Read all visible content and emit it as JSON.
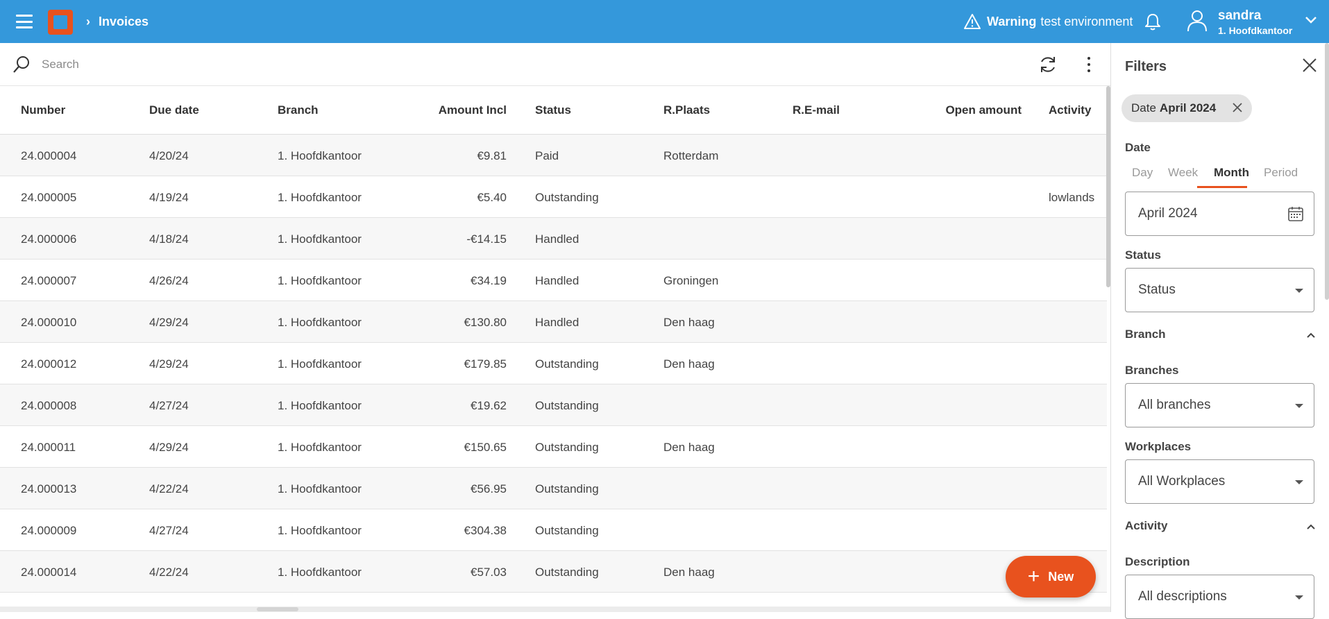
{
  "header": {
    "breadcrumb_title": "Invoices",
    "warning_bold": "Warning",
    "warning_text": "test environment",
    "user_name": "sandra",
    "user_branch": "1. Hoofdkantoor",
    "colors": {
      "bar": "#3498db",
      "accent": "#e8521e"
    }
  },
  "search": {
    "placeholder": "Search"
  },
  "table": {
    "columns": [
      "Number",
      "Due date",
      "Branch",
      "Amount Incl",
      "Status",
      "R.Plaats",
      "R.E-mail",
      "Open amount",
      "Activity"
    ],
    "rows": [
      {
        "number": "24.000004",
        "due": "4/20/24",
        "branch": "1. Hoofdkantoor",
        "amount": "€9.81",
        "status": "Paid",
        "plaats": "Rotterdam",
        "email": "",
        "open": "",
        "activity": ""
      },
      {
        "number": "24.000005",
        "due": "4/19/24",
        "branch": "1. Hoofdkantoor",
        "amount": "€5.40",
        "status": "Outstanding",
        "plaats": "",
        "email": "",
        "open": "",
        "activity": "lowlands"
      },
      {
        "number": "24.000006",
        "due": "4/18/24",
        "branch": "1. Hoofdkantoor",
        "amount": "-€14.15",
        "status": "Handled",
        "plaats": "",
        "email": "",
        "open": "",
        "activity": ""
      },
      {
        "number": "24.000007",
        "due": "4/26/24",
        "branch": "1. Hoofdkantoor",
        "amount": "€34.19",
        "status": "Handled",
        "plaats": "Groningen",
        "email": "",
        "open": "",
        "activity": ""
      },
      {
        "number": "24.000010",
        "due": "4/29/24",
        "branch": "1. Hoofdkantoor",
        "amount": "€130.80",
        "status": "Handled",
        "plaats": "Den haag",
        "email": "",
        "open": "",
        "activity": ""
      },
      {
        "number": "24.000012",
        "due": "4/29/24",
        "branch": "1. Hoofdkantoor",
        "amount": "€179.85",
        "status": "Outstanding",
        "plaats": "Den haag",
        "email": "",
        "open": "",
        "activity": ""
      },
      {
        "number": "24.000008",
        "due": "4/27/24",
        "branch": "1. Hoofdkantoor",
        "amount": "€19.62",
        "status": "Outstanding",
        "plaats": "",
        "email": "",
        "open": "",
        "activity": ""
      },
      {
        "number": "24.000011",
        "due": "4/29/24",
        "branch": "1. Hoofdkantoor",
        "amount": "€150.65",
        "status": "Outstanding",
        "plaats": "Den haag",
        "email": "",
        "open": "",
        "activity": ""
      },
      {
        "number": "24.000013",
        "due": "4/22/24",
        "branch": "1. Hoofdkantoor",
        "amount": "€56.95",
        "status": "Outstanding",
        "plaats": "",
        "email": "",
        "open": "",
        "activity": ""
      },
      {
        "number": "24.000009",
        "due": "4/27/24",
        "branch": "1. Hoofdkantoor",
        "amount": "€304.38",
        "status": "Outstanding",
        "plaats": "",
        "email": "",
        "open": "",
        "activity": ""
      },
      {
        "number": "24.000014",
        "due": "4/22/24",
        "branch": "1. Hoofdkantoor",
        "amount": "€57.03",
        "status": "Outstanding",
        "plaats": "Den haag",
        "email": "",
        "open": "",
        "activity": ""
      }
    ]
  },
  "fab": {
    "label": "New"
  },
  "filters": {
    "title": "Filters",
    "chip_label": "Date",
    "chip_value": "April 2024",
    "date_label": "Date",
    "date_tabs": [
      "Day",
      "Week",
      "Month",
      "Period"
    ],
    "date_active_tab": "Month",
    "date_value": "April 2024",
    "status_label": "Status",
    "status_value": "Status",
    "branch_section": "Branch",
    "branches_label": "Branches",
    "branches_value": "All branches",
    "workplaces_label": "Workplaces",
    "workplaces_value": "All Workplaces",
    "activity_section": "Activity",
    "description_label": "Description",
    "description_value": "All descriptions"
  }
}
